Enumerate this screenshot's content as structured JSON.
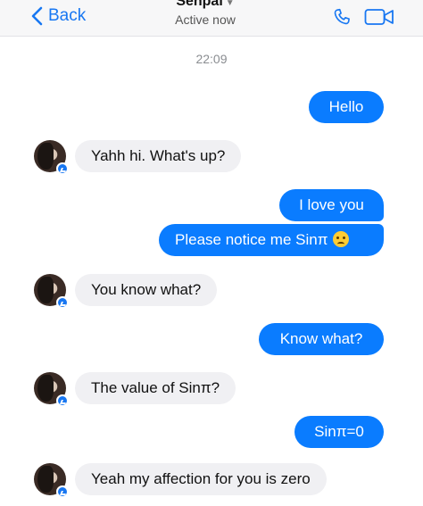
{
  "header": {
    "back_label": "Back",
    "contact_name": "Senpai",
    "status": "Active now",
    "accent_color": "#1877f2",
    "icons": [
      "chevron-left-icon",
      "chevron-down-icon",
      "phone-icon",
      "video-camera-icon"
    ]
  },
  "timestamp": "22:09",
  "messages": [
    {
      "from": "me",
      "text": "Hello"
    },
    {
      "from": "them",
      "text": "Yahh hi. What's up?"
    },
    {
      "from": "me",
      "text": "I love you"
    },
    {
      "from": "me",
      "text": "Please notice me Sinπ",
      "emoji": "sad-face-emoji"
    },
    {
      "from": "them",
      "text": "You know what?"
    },
    {
      "from": "me",
      "text": "Know what?"
    },
    {
      "from": "them",
      "text": "The value of Sinπ?"
    },
    {
      "from": "me",
      "text": "Sinπ=0"
    },
    {
      "from": "them",
      "text": "Yeah my affection for you is zero"
    }
  ],
  "colors": {
    "outgoing_bubble": "#0a7cff",
    "incoming_bubble": "#f0f0f3"
  }
}
